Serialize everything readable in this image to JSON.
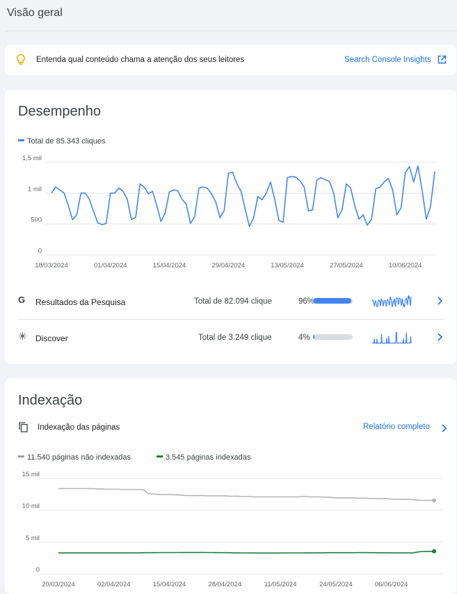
{
  "page": {
    "title": "Visão geral"
  },
  "banner": {
    "icon": "lightbulb-icon",
    "text": "Entenda qual conteúdo chama a atenção dos seus leitores",
    "link_label": "Search Console Insights",
    "link_icon": "open-in-new-icon",
    "accent": "#f9ab00"
  },
  "performance": {
    "title": "Desempenho",
    "legend": "Total de 85.343 cliques",
    "series_color": "#4285f4",
    "rows": [
      {
        "icon": "google-g-icon",
        "label": "Resultados da Pesquisa",
        "total": "Total de 82.094 clique",
        "percent_text": "96%",
        "share": 0.96
      },
      {
        "icon": "discover-asterisk-icon",
        "label": "Discover",
        "total": "Total de 3.249 clique",
        "percent_text": "4%",
        "share": 0.04
      }
    ],
    "row_chevron_icon": "chevron-right-icon"
  },
  "indexing": {
    "title": "Indexação",
    "section_icon": "pages-copy-icon",
    "section_label": "Indexação das páginas",
    "report_link": "Relatório completo",
    "report_chevron_icon": "chevron-right-icon",
    "legend_not_indexed": "11.540 páginas não indexadas",
    "legend_indexed": "3.545 páginas indexadas",
    "color_not_indexed": "#bdbdbd",
    "color_indexed": "#188038"
  },
  "chart_data": [
    {
      "type": "line",
      "title": "",
      "xlabel": "",
      "ylabel": "",
      "ylim": [
        0,
        1500
      ],
      "y_ticks": [
        0,
        500,
        1000,
        1500
      ],
      "y_tick_labels": [
        "0",
        "500",
        "1 mil",
        "1,5 mil"
      ],
      "x_tick_labels": [
        "18/03/2024",
        "01/04/2024",
        "15/04/2024",
        "29/04/2024",
        "13/05/2024",
        "27/05/2024",
        "10/06/2024"
      ],
      "x_tick_index": [
        0,
        14,
        28,
        42,
        56,
        70,
        84
      ],
      "grid": true,
      "series": [
        {
          "name": "Total de 85.343 cliques",
          "values": [
            1000,
            1100,
            1050,
            1000,
            800,
            570,
            650,
            1000,
            1000,
            900,
            700,
            520,
            490,
            510,
            1000,
            1000,
            1080,
            1030,
            900,
            570,
            610,
            1150,
            1100,
            990,
            1030,
            800,
            540,
            680,
            1020,
            1050,
            1040,
            900,
            820,
            510,
            620,
            1080,
            1100,
            1080,
            990,
            860,
            600,
            720,
            1320,
            1340,
            1150,
            1030,
            740,
            460,
            600,
            950,
            890,
            1000,
            1180,
            900,
            560,
            530,
            1250,
            1270,
            1260,
            1200,
            1100,
            710,
            730,
            1210,
            1250,
            1220,
            1190,
            1000,
            600,
            730,
            1150,
            1090,
            800,
            580,
            650,
            480,
            580,
            1070,
            1100,
            1180,
            1240,
            1050,
            650,
            760,
            1330,
            1430,
            1180,
            1440,
            1050,
            580,
            780,
            1350
          ]
        }
      ]
    },
    {
      "type": "line",
      "title": "",
      "xlabel": "",
      "ylabel": "",
      "ylim": [
        0,
        15000
      ],
      "y_ticks": [
        0,
        5000,
        10000,
        15000
      ],
      "y_tick_labels": [
        "0",
        "5 mil",
        "10 mil",
        "15 mil"
      ],
      "x_tick_labels": [
        "20/03/2024",
        "02/04/2024",
        "15/04/2024",
        "28/04/2024",
        "11/05/2024",
        "24/05/2024",
        "06/06/2024"
      ],
      "x_tick_index": [
        0,
        13,
        26,
        39,
        52,
        65,
        78
      ],
      "grid": true,
      "series": [
        {
          "name": "11.540 páginas não indexadas",
          "values": [
            13400,
            13400,
            13400,
            13400,
            13400,
            13400,
            13400,
            13400,
            13400,
            13350,
            13350,
            13300,
            13300,
            13300,
            13300,
            13250,
            13250,
            13250,
            13250,
            13250,
            13200,
            12600,
            12550,
            12500,
            12450,
            12450,
            12450,
            12450,
            12400,
            12350,
            12300,
            12300,
            12300,
            12300,
            12300,
            12250,
            12250,
            12250,
            12250,
            12250,
            12200,
            12200,
            12200,
            12150,
            12150,
            12150,
            12100,
            12100,
            12100,
            12100,
            12100,
            12100,
            12100,
            12100,
            12100,
            12100,
            12100,
            12150,
            12150,
            12100,
            12100,
            12100,
            12050,
            12050,
            12000,
            11950,
            11950,
            11950,
            11950,
            11950,
            11900,
            11900,
            11900,
            11850,
            11850,
            11800,
            11800,
            11800,
            11750,
            11700,
            11700,
            11700,
            11700,
            11650,
            11600,
            11550,
            11540,
            11540,
            11540
          ]
        },
        {
          "name": "3.545 páginas indexadas",
          "values": [
            3300,
            3300,
            3300,
            3300,
            3300,
            3300,
            3300,
            3300,
            3300,
            3300,
            3300,
            3300,
            3300,
            3300,
            3300,
            3300,
            3300,
            3300,
            3300,
            3300,
            3320,
            3320,
            3330,
            3330,
            3340,
            3340,
            3340,
            3340,
            3340,
            3350,
            3350,
            3350,
            3350,
            3350,
            3350,
            3340,
            3340,
            3330,
            3330,
            3320,
            3320,
            3300,
            3300,
            3280,
            3280,
            3270,
            3270,
            3260,
            3260,
            3260,
            3260,
            3260,
            3270,
            3270,
            3280,
            3280,
            3290,
            3290,
            3300,
            3300,
            3300,
            3310,
            3310,
            3320,
            3320,
            3320,
            3320,
            3320,
            3320,
            3320,
            3330,
            3330,
            3330,
            3320,
            3320,
            3310,
            3310,
            3310,
            3300,
            3300,
            3300,
            3300,
            3300,
            3300,
            3400,
            3500,
            3520,
            3530,
            3545
          ]
        }
      ]
    }
  ]
}
